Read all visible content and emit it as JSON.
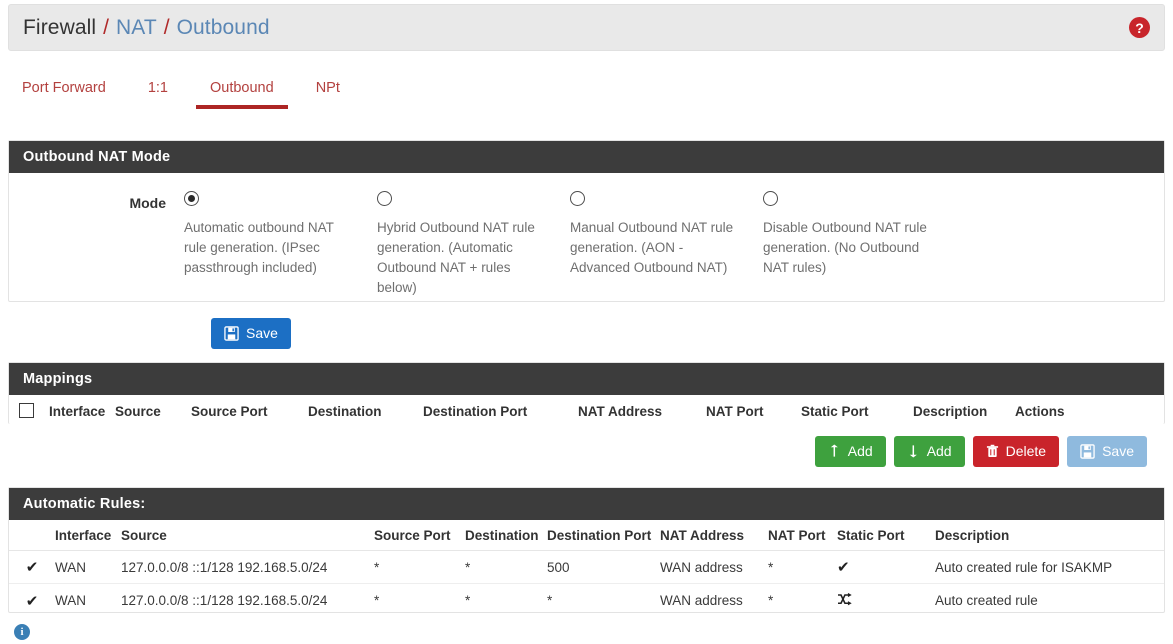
{
  "breadcrumb": {
    "app": "Firewall",
    "sep": "/",
    "section": "NAT",
    "page": "Outbound",
    "help_icon": "question-mark-help-icon",
    "help_glyph": "?"
  },
  "tabs": [
    {
      "label": "Port Forward",
      "active": false
    },
    {
      "label": "1:1",
      "active": false
    },
    {
      "label": "Outbound",
      "active": true
    },
    {
      "label": "NPt",
      "active": false
    }
  ],
  "mode_panel": {
    "title": "Outbound NAT Mode",
    "field_label": "Mode",
    "options": [
      {
        "selected": true,
        "description": "Automatic outbound NAT rule generation. (IPsec passthrough included)"
      },
      {
        "selected": false,
        "description": "Hybrid Outbound NAT rule generation. (Automatic Outbound NAT + rules below)"
      },
      {
        "selected": false,
        "description": "Manual Outbound NAT rule generation. (AON - Advanced Outbound NAT)"
      },
      {
        "selected": false,
        "description": "Disable Outbound NAT rule generation. (No Outbound NAT rules)"
      }
    ],
    "save_label": "Save",
    "save_icon": "floppy-disk-save-icon"
  },
  "mappings": {
    "title": "Mappings",
    "select_all_icon": "checkbox-unchecked-icon",
    "columns": [
      "Interface",
      "Source",
      "Source Port",
      "Destination",
      "Destination Port",
      "NAT Address",
      "NAT Port",
      "Static Port",
      "Description",
      "Actions"
    ],
    "rows": [],
    "actions": [
      {
        "label": "Add",
        "style": "success",
        "icon": "arrow-up-add-icon"
      },
      {
        "label": "Add",
        "style": "success",
        "icon": "arrow-down-add-icon"
      },
      {
        "label": "Delete",
        "style": "danger",
        "icon": "trash-delete-icon"
      },
      {
        "label": "Save",
        "style": "muted",
        "icon": "floppy-disk-save-icon"
      }
    ]
  },
  "auto_rules": {
    "title": "Automatic Rules:",
    "columns": [
      "Interface",
      "Source",
      "Source Port",
      "Destination",
      "Destination Port",
      "NAT Address",
      "NAT Port",
      "Static Port",
      "Description"
    ],
    "rows": [
      {
        "enabled_icon": "checkmark-enabled-icon",
        "interface": "WAN",
        "source": "127.0.0.0/8 ::1/128 192.168.5.0/24",
        "source_port": "*",
        "destination": "*",
        "destination_port": "500",
        "nat_address": "WAN address",
        "nat_port": "*",
        "static_port_icon": "checkmark-static-port-icon",
        "description": "Auto created rule for ISAKMP"
      },
      {
        "enabled_icon": "checkmark-enabled-icon",
        "interface": "WAN",
        "source": "127.0.0.0/8 ::1/128 192.168.5.0/24",
        "source_port": "*",
        "destination": "*",
        "destination_port": "*",
        "nat_address": "WAN address",
        "nat_port": "*",
        "static_port_icon": "shuffle-random-port-icon",
        "description": "Auto created rule"
      }
    ]
  },
  "footer": {
    "info_icon": "information-icon",
    "info_glyph": "i"
  },
  "colors": {
    "panel_header": "#3c3c3c",
    "accent_red": "#ad2524",
    "link_blue": "#5b87b5",
    "primary_blue": "#1c6fc4",
    "success_green": "#3ea13e",
    "danger_red": "#c9242b",
    "muted_blue": "#8fbade",
    "info_blue": "#3a7fb5"
  }
}
